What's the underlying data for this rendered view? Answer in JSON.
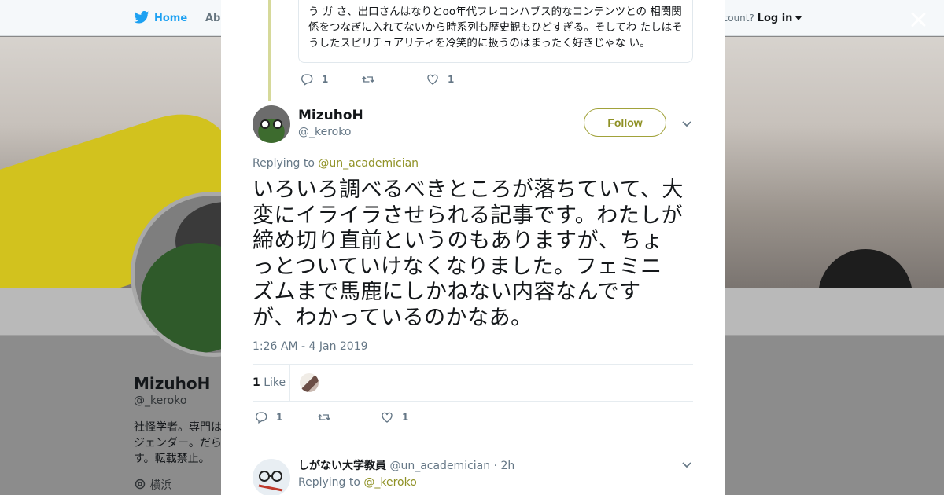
{
  "background": {
    "nav": {
      "home": "Home",
      "about": "Abo",
      "account_prompt": "ccount?",
      "login": "Log in"
    },
    "profile": {
      "name": "MizuhoH",
      "handle": "@_keroko",
      "bio": "社怪学者。専門は ジェンダー。だら す。転載禁止。",
      "location": "横浜"
    }
  },
  "modal": {
    "previous_tweet": {
      "text": "う ガ さ、出口さんはなりとoo年代フレコンハブス的なコンテンツとの 相関関係をつなぎに入れてないから時系列も歴史観もひどすぎる。そしてわ たしはそうしたスピリチュアリティを冷笑的に扱うのはまったく好きじゃな い。",
      "reply_count": "1",
      "like_count": "1"
    },
    "focused_tweet": {
      "author_name": "MizuhoH",
      "author_handle": "@_keroko",
      "follow_label": "Follow",
      "replying_prefix": "Replying to ",
      "replying_to": "@un_academician",
      "text": "いろいろ調べるべきところが落ちていて、大変にイライラさせられる記事です。わたしが締め切り直前というのもありますが、ちょっとついていけなくなりました。フェミニズムまで馬鹿にしかねない内容なんですが、わかっているのかなあ。",
      "timestamp": "1:26 AM - 4 Jan 2019",
      "like_total": "1",
      "like_word": "Like",
      "reply_count": "1",
      "like_count": "1"
    },
    "reply_tweet": {
      "author_name": "しがない大学教員",
      "author_handle": "@un_academician",
      "time": "· 2h",
      "replying_prefix": "Replying to ",
      "replying_to": "@_keroko"
    }
  },
  "colors": {
    "accent": "#8f9125",
    "twitter_blue": "#1da1f2",
    "thread_line": "#d6d99a"
  },
  "icons": [
    "twitter-bird-icon",
    "chevron-down-icon",
    "close-icon",
    "reply-icon",
    "retweet-icon",
    "heart-icon",
    "location-pin-icon"
  ]
}
